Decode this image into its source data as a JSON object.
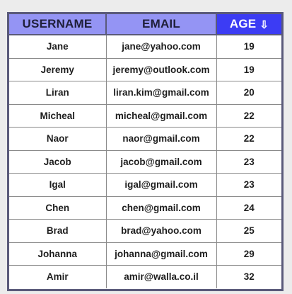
{
  "table": {
    "headers": {
      "username": "USERNAME",
      "email": "EMAIL",
      "age": "AGE",
      "age_sort_icon": "sort-descending-arrow-icon"
    },
    "sorted_column": "AGE",
    "rows": [
      {
        "username": "Jane",
        "email": "jane@yahoo.com",
        "age": "19"
      },
      {
        "username": "Jeremy",
        "email": "jeremy@outlook.com",
        "age": "19"
      },
      {
        "username": "Liran",
        "email": "liran.kim@gmail.com",
        "age": "20"
      },
      {
        "username": "Micheal",
        "email": "micheal@gmail.com",
        "age": "22"
      },
      {
        "username": "Naor",
        "email": "naor@gmail.com",
        "age": "22"
      },
      {
        "username": "Jacob",
        "email": "jacob@gmail.com",
        "age": "23"
      },
      {
        "username": "Igal",
        "email": "igal@gmail.com",
        "age": "23"
      },
      {
        "username": "Chen",
        "email": "chen@gmail.com",
        "age": "24"
      },
      {
        "username": "Brad",
        "email": "brad@yahoo.com",
        "age": "25"
      },
      {
        "username": "Johanna",
        "email": "johanna@gmail.com",
        "age": "29"
      },
      {
        "username": "Amir",
        "email": "amir@walla.co.il",
        "age": "32"
      }
    ]
  },
  "colors": {
    "header_bg": "#9494f4",
    "sorted_header_bg": "#3c3cf4",
    "border": "#5a5a7a",
    "page_bg": "#ececec"
  }
}
